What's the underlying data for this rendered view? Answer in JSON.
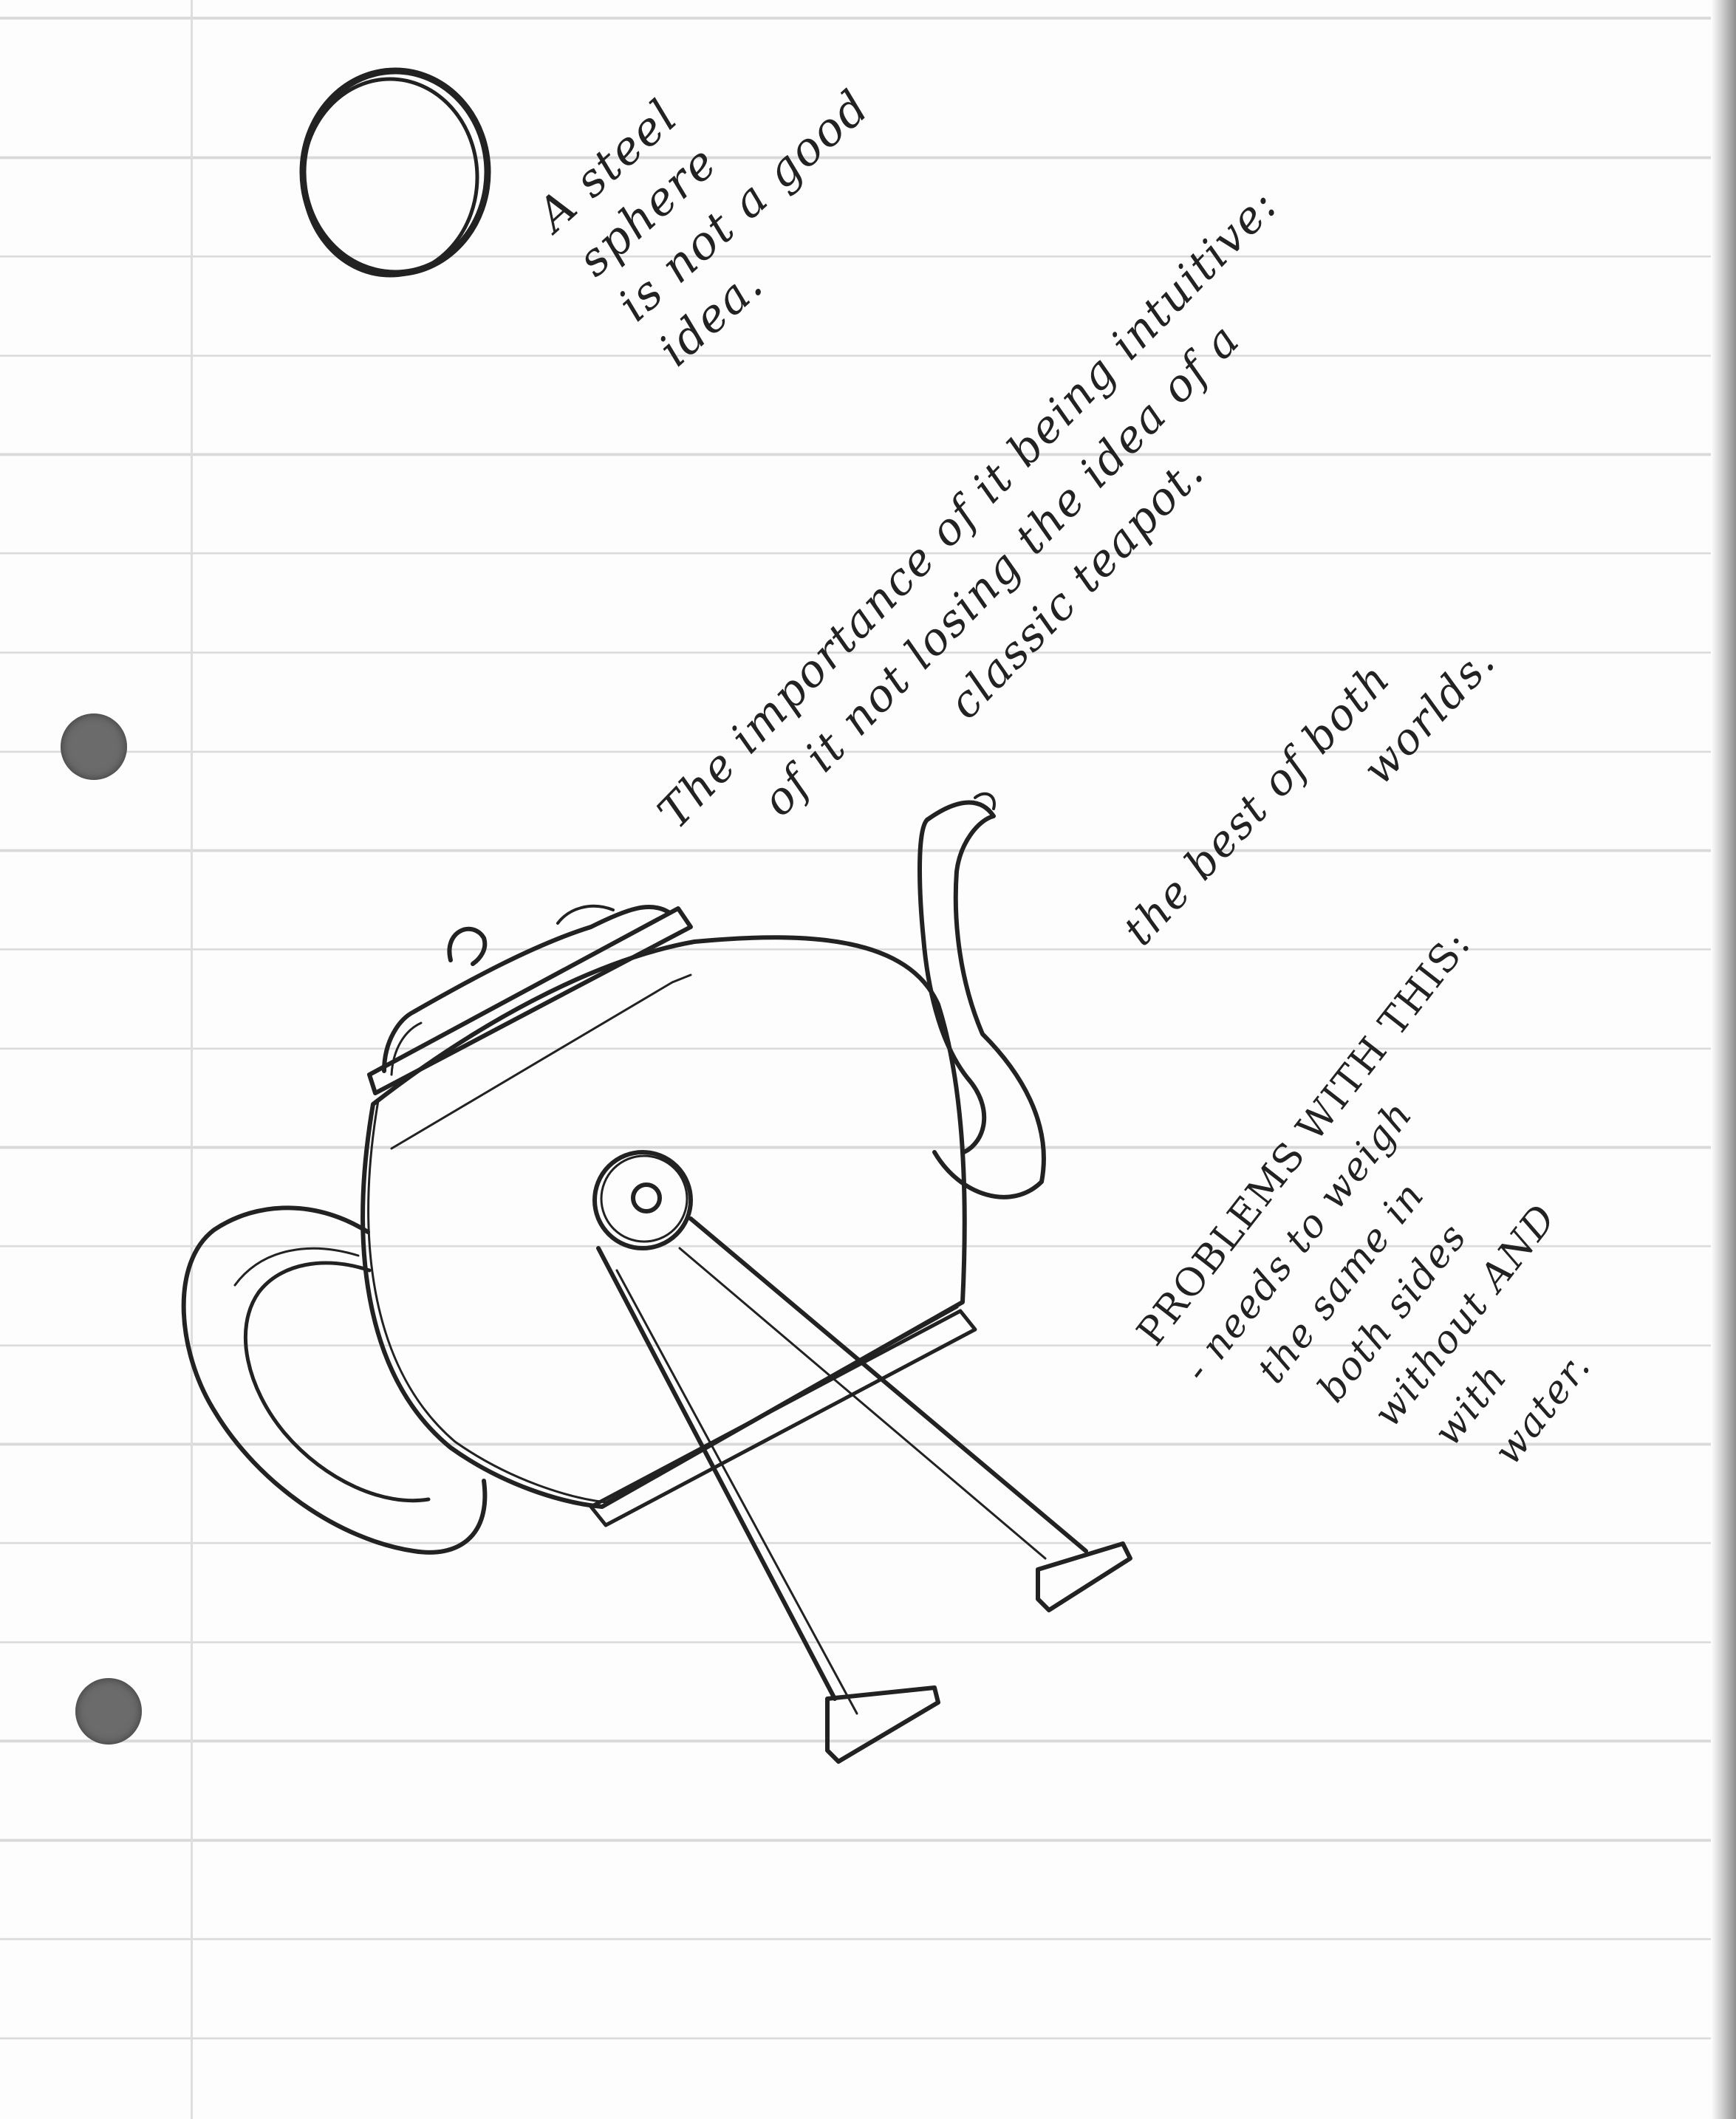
{
  "notes": {
    "steel_sphere": [
      "A steel",
      "sphere",
      "is not a good",
      "idea."
    ],
    "importance": [
      "The importance of it being intuitive:",
      "of it not losing the idea of a",
      "classic teapot."
    ],
    "best_of_both": [
      "the best of both",
      "worlds."
    ],
    "problems": [
      "PROBLEMS WITH THIS:",
      "- needs to weigh",
      "the same in",
      "both sides",
      "without AND",
      "with",
      "water."
    ]
  },
  "colors": {
    "ink": "#222222",
    "paper": "#fdfdfd",
    "rule": "#d9d9d9",
    "punch_hole": "#6b6b6b"
  }
}
